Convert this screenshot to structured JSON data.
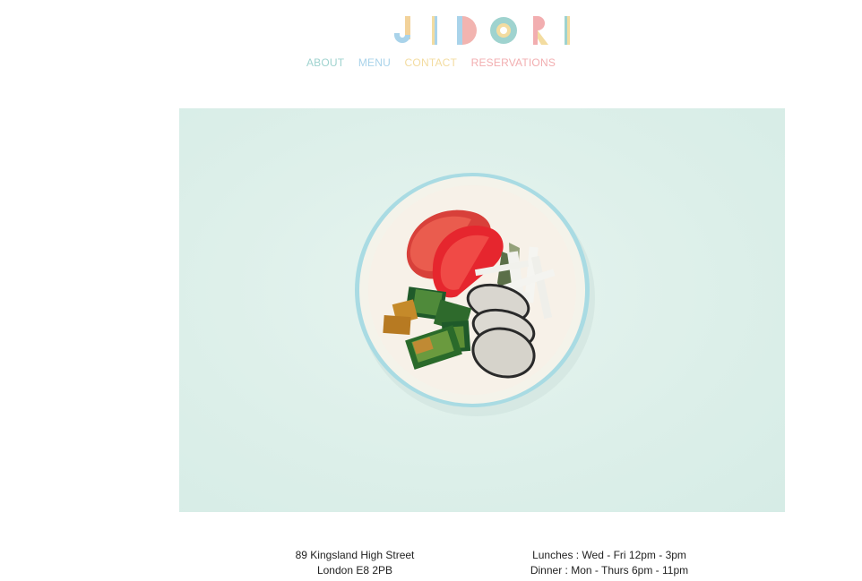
{
  "brand": {
    "name": "JIDORI"
  },
  "nav": {
    "items": [
      {
        "label": "ABOUT",
        "color": "#9fd3cf"
      },
      {
        "label": "MENU",
        "color": "#a9d3ea"
      },
      {
        "label": "CONTACT",
        "color": "#f3dca0"
      },
      {
        "label": "RESERVATIONS",
        "color": "#f2aeb0"
      }
    ]
  },
  "hero": {
    "icon": "food-plate-photo"
  },
  "footer": {
    "address": {
      "line1": "89 Kingsland High Street",
      "line2": "London E8 2PB"
    },
    "hours": {
      "line1": "Lunches : Wed - Fri 12pm - 3pm",
      "line2": "Dinner : Mon - Thurs 6pm - 11pm"
    }
  }
}
